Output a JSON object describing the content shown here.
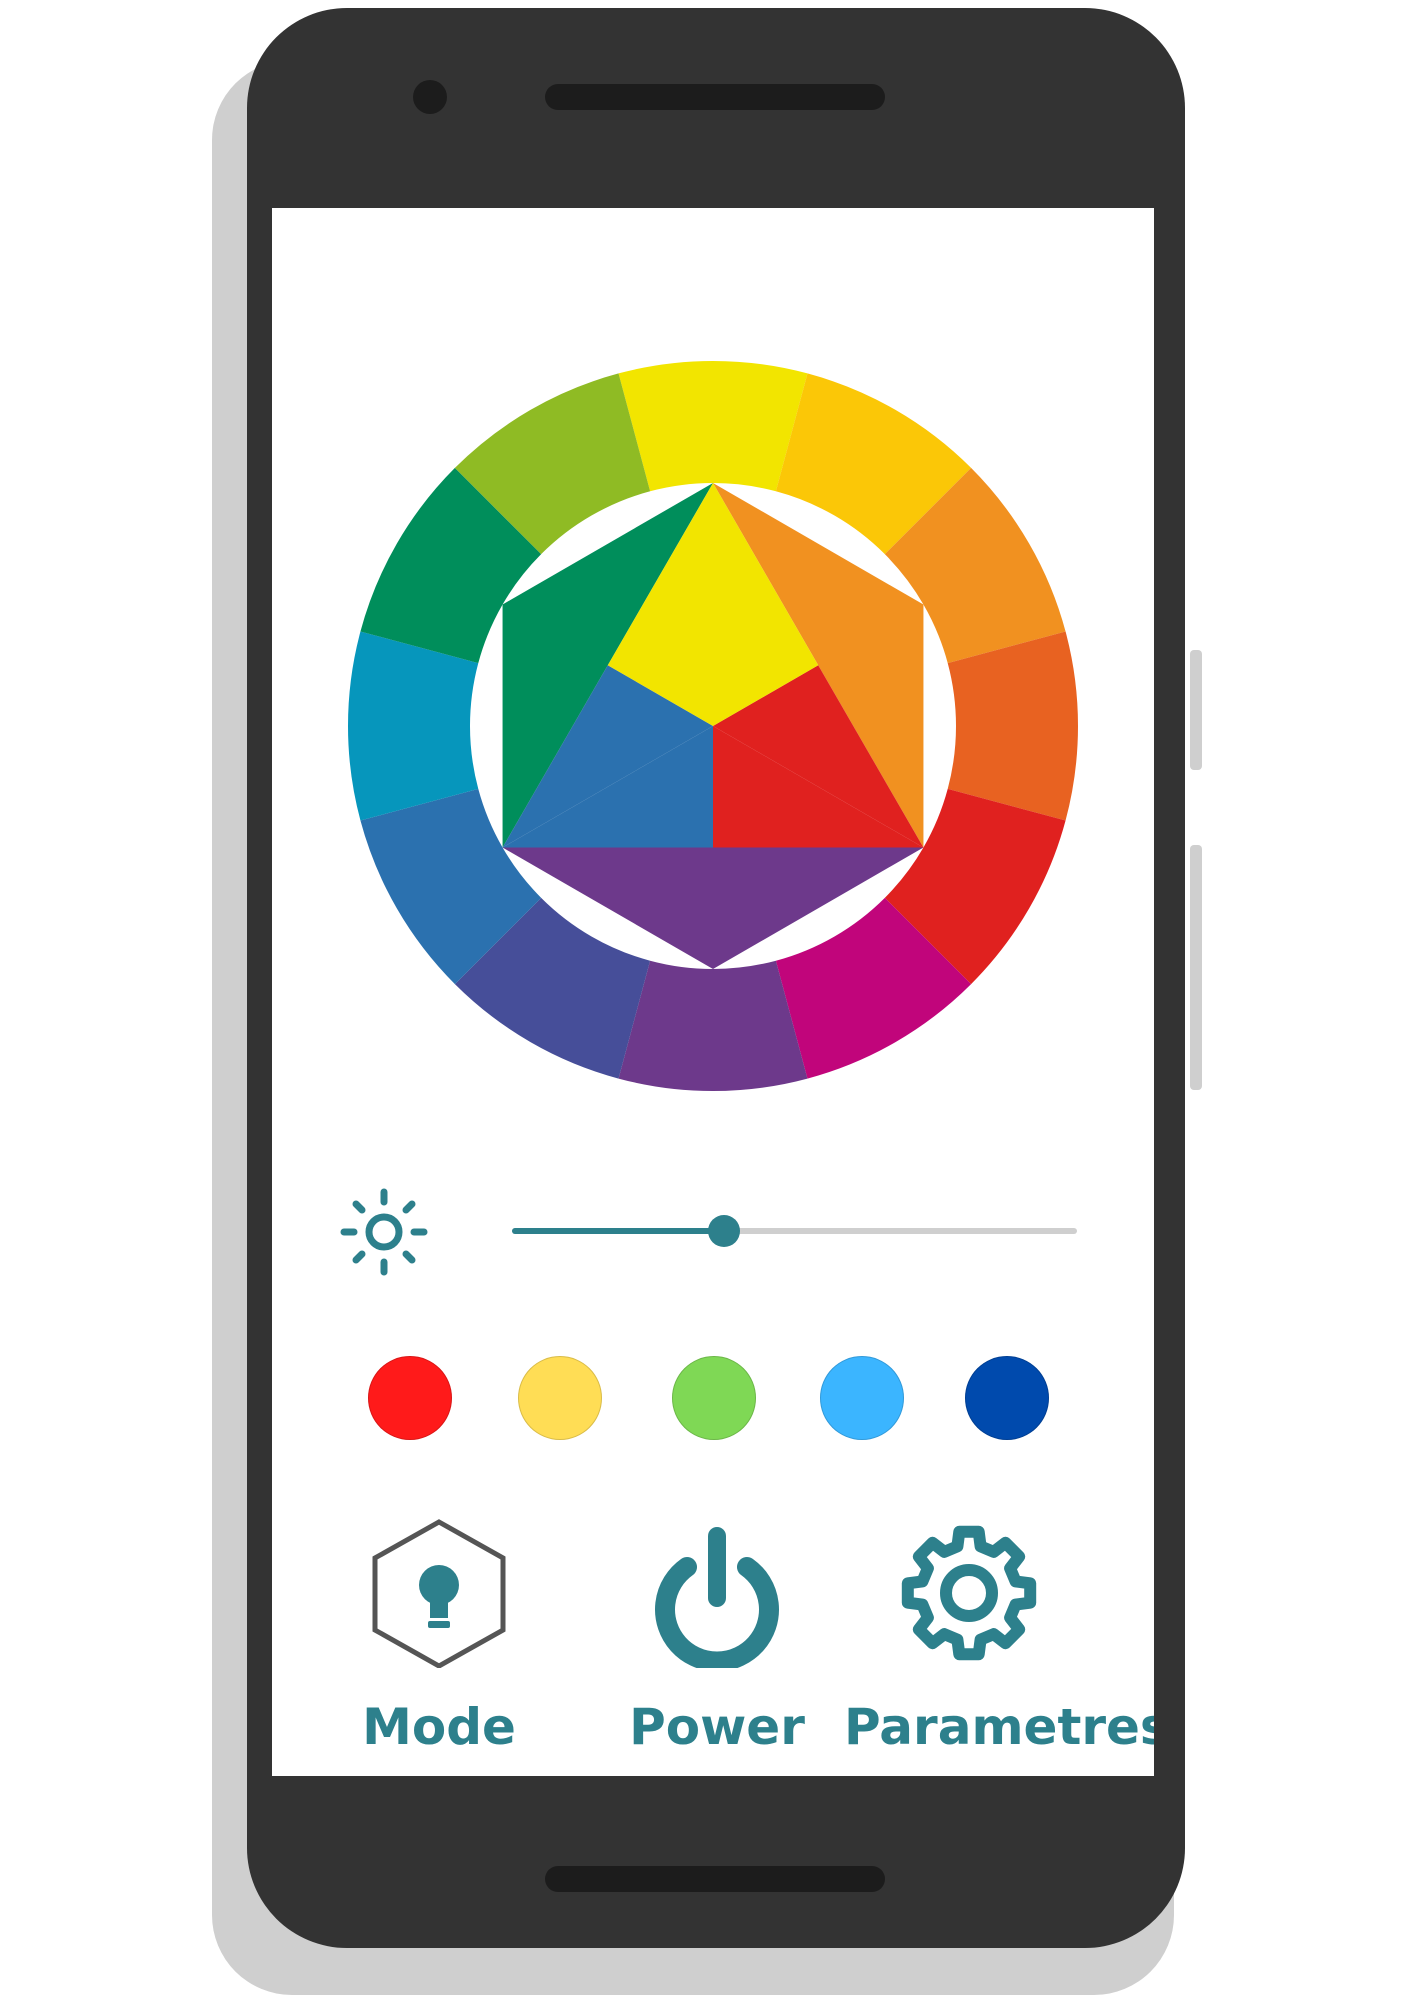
{
  "colors": {
    "accent": "#2d808c",
    "phone_frame": "#333333",
    "hexagon_outline": "#555555"
  },
  "color_wheel": {
    "outer_segments": [
      "#f2e500",
      "#fbc707",
      "#f19120",
      "#e86221",
      "#e0211f",
      "#c1057b",
      "#6d398b",
      "#464e99",
      "#2b71af",
      "#0696bc",
      "#008e5b",
      "#8fbb24"
    ],
    "inner_triangles": {
      "top": "#f2e500",
      "top_left": "#008e5b",
      "top_right": "#f19120",
      "bottom_left": "#2b71af",
      "bottom_right": "#e0211f",
      "bottom": "#6d398b"
    }
  },
  "brightness": {
    "icon": "sun-icon",
    "level": 0.375
  },
  "swatches": [
    {
      "name": "red",
      "color": "#ff1a1a"
    },
    {
      "name": "yellow",
      "color": "#ffdd55"
    },
    {
      "name": "green",
      "color": "#7fd855"
    },
    {
      "name": "light-blue",
      "color": "#3bb5ff"
    },
    {
      "name": "dark-blue",
      "color": "#004aad"
    }
  ],
  "nav": {
    "mode": {
      "label": "Mode",
      "icon": "lightbulb-hexagon-icon"
    },
    "power": {
      "label": "Power",
      "icon": "power-icon"
    },
    "settings": {
      "label": "Parametres",
      "icon": "gear-icon"
    }
  }
}
